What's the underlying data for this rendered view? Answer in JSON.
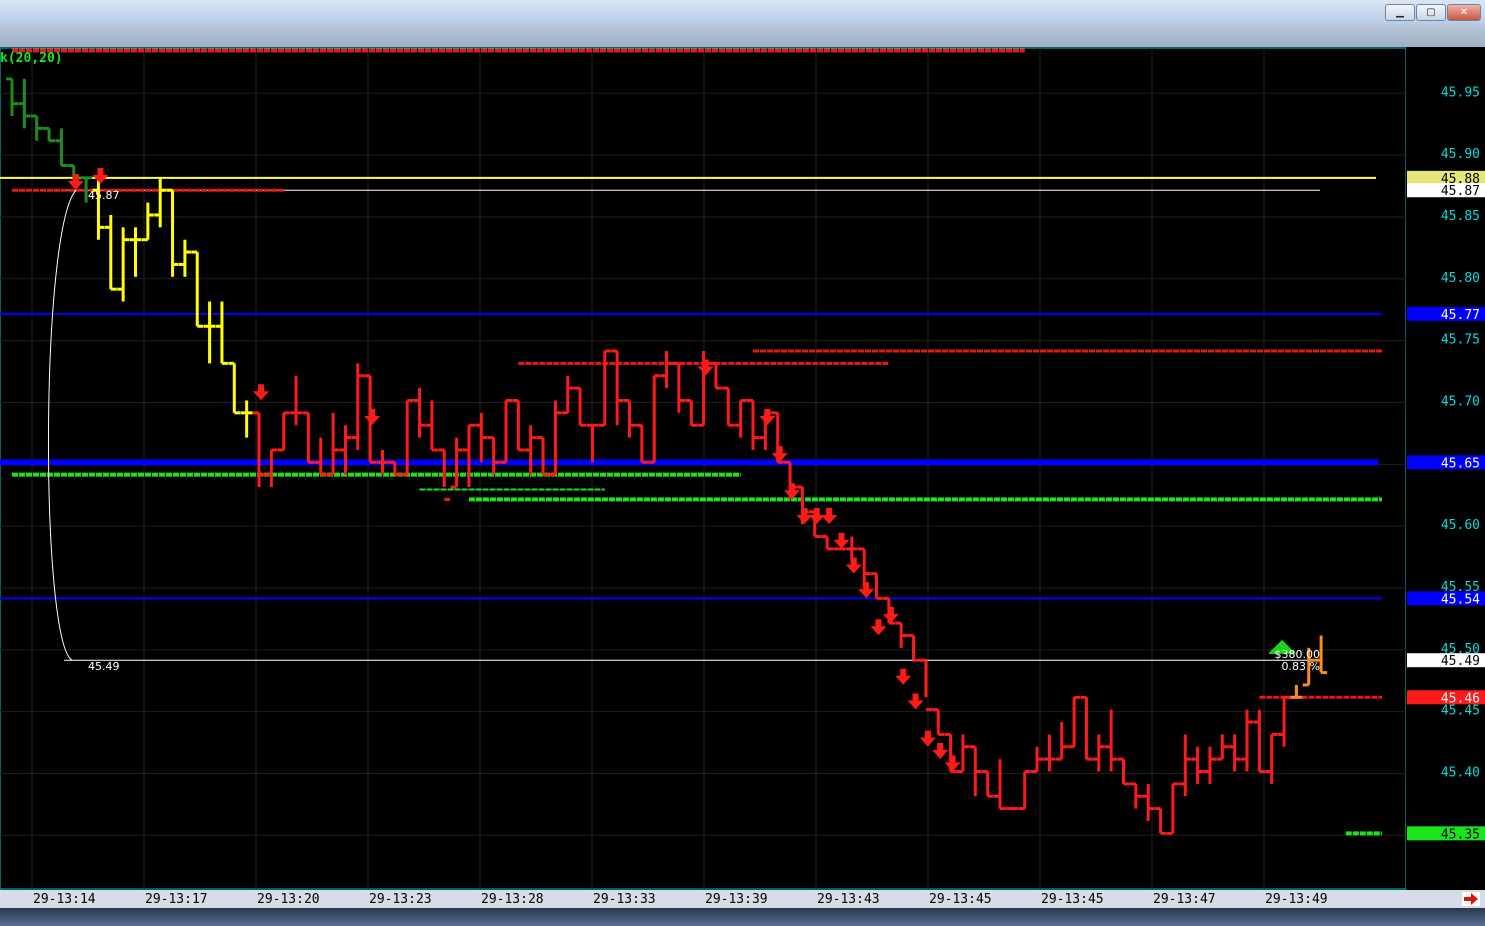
{
  "window": {
    "min_label": "▁",
    "max_label": "▢",
    "close_label": "✕"
  },
  "colors": {
    "background": "#000000",
    "grid": "#1f1f1f",
    "axis_border": "#00c8c8",
    "axis_text": "#00dede",
    "up_bar": "#ffff00",
    "down_bar": "#ff1a1a",
    "early_bar": "#1e8c1e",
    "recent_bar": "#ff8c1a",
    "blue_level": "#0000ff",
    "green_level": "#19e619",
    "red_level": "#e61919",
    "yellow_level": "#ffff4d",
    "white_level": "#ffffff",
    "sell_arrow": "#ff1a1a",
    "buy_arrow": "#1ad41a"
  },
  "chart_data": {
    "type": "ohlc",
    "indicator_label": "k(20,20)",
    "y_range": [
      45.305,
      45.985
    ],
    "y_ticks": [
      45.95,
      45.9,
      45.85,
      45.8,
      45.75,
      45.7,
      45.65,
      45.6,
      45.55,
      45.5,
      45.45,
      45.4,
      45.35
    ],
    "time_labels": [
      "29-13:14",
      "29-13:17",
      "29-13:20",
      "29-13:23",
      "29-13:28",
      "29-13:33",
      "29-13:39",
      "29-13:43",
      "29-13:45",
      "29-13:45",
      "29-13:47",
      "29-13:49"
    ],
    "price_tags": [
      {
        "value": 45.88,
        "text": "45.88",
        "bg": "#e6e678",
        "fg": "#000000"
      },
      {
        "value": 45.87,
        "text": "45.87",
        "bg": "#ffffff",
        "fg": "#000000"
      },
      {
        "value": 45.77,
        "text": "45.77",
        "bg": "#0000ff",
        "fg": "#ffffff"
      },
      {
        "value": 45.65,
        "text": "45.65",
        "bg": "#0000ff",
        "fg": "#ffffff"
      },
      {
        "value": 45.54,
        "text": "45.54",
        "bg": "#0000ff",
        "fg": "#ffffff"
      },
      {
        "value": 45.49,
        "text": "45.49",
        "bg": "#ffffff",
        "fg": "#000000"
      },
      {
        "value": 45.46,
        "text": "45.46",
        "bg": "#ff1a1a",
        "fg": "#ffffff"
      },
      {
        "value": 45.35,
        "text": "45.35",
        "bg": "#19e619",
        "fg": "#000000"
      }
    ],
    "trade_annotation": {
      "start_price": 45.87,
      "end_price": 45.49,
      "start_label": "45.87",
      "end_label": "45.49",
      "profit": "$380.00",
      "percent": "0.83 %"
    },
    "levels": [
      {
        "kind": "yellow",
        "value": 45.88,
        "from": 0,
        "to": 111
      },
      {
        "kind": "white",
        "value": 45.87,
        "from": 6,
        "to": 107
      },
      {
        "kind": "blue",
        "value": 45.77,
        "from": 0,
        "to": 111
      },
      {
        "kind": "blue_thick",
        "value": 45.65,
        "from": 0,
        "to": 111
      },
      {
        "kind": "blue",
        "value": 45.54,
        "from": 0,
        "to": 111
      },
      {
        "kind": "white",
        "value": 45.49,
        "from": 6,
        "to": 107
      },
      {
        "kind": "red_dash",
        "value": 45.983,
        "from": 0,
        "to": 82
      },
      {
        "kind": "red_dash",
        "value": 45.87,
        "from": 0,
        "to": 22
      },
      {
        "kind": "red_dash",
        "value": 45.73,
        "from": 41,
        "to": 71
      },
      {
        "kind": "red_dash",
        "value": 45.74,
        "from": 60,
        "to": 112
      },
      {
        "kind": "red_dash",
        "value": 45.46,
        "from": 101,
        "to": 112
      },
      {
        "kind": "green_dash",
        "value": 45.64,
        "from": 0,
        "to": 59
      },
      {
        "kind": "green_dash",
        "value": 45.628,
        "from": 33,
        "to": 48
      },
      {
        "kind": "green_dash",
        "value": 45.62,
        "from": 37,
        "to": 112
      },
      {
        "kind": "green_dash",
        "value": 45.35,
        "from": 108,
        "to": 112
      }
    ],
    "bars": [
      [
        45.96,
        45.96,
        45.93,
        45.94,
        "g"
      ],
      [
        45.94,
        45.96,
        45.92,
        45.93,
        "g"
      ],
      [
        45.93,
        45.93,
        45.91,
        45.92,
        "g"
      ],
      [
        45.92,
        45.92,
        45.91,
        45.91,
        "g"
      ],
      [
        45.91,
        45.92,
        45.89,
        45.89,
        "g"
      ],
      [
        45.89,
        45.89,
        45.88,
        45.88,
        "g"
      ],
      [
        45.88,
        45.88,
        45.86,
        45.88,
        "g"
      ],
      [
        45.87,
        45.88,
        45.83,
        45.84,
        "y"
      ],
      [
        45.84,
        45.85,
        45.79,
        45.79,
        "y"
      ],
      [
        45.79,
        45.84,
        45.78,
        45.83,
        "y"
      ],
      [
        45.83,
        45.84,
        45.8,
        45.83,
        "y"
      ],
      [
        45.83,
        45.86,
        45.83,
        45.85,
        "y"
      ],
      [
        45.85,
        45.88,
        45.84,
        45.87,
        "y"
      ],
      [
        45.87,
        45.87,
        45.8,
        45.81,
        "y"
      ],
      [
        45.81,
        45.83,
        45.8,
        45.82,
        "y"
      ],
      [
        45.82,
        45.82,
        45.76,
        45.76,
        "y"
      ],
      [
        45.76,
        45.78,
        45.73,
        45.76,
        "y"
      ],
      [
        45.76,
        45.78,
        45.73,
        45.73,
        "y"
      ],
      [
        45.73,
        45.73,
        45.69,
        45.69,
        "y"
      ],
      [
        45.69,
        45.7,
        45.67,
        45.69,
        "y"
      ],
      [
        45.69,
        45.69,
        45.63,
        45.64,
        "r"
      ],
      [
        45.64,
        45.66,
        45.63,
        45.66,
        "r"
      ],
      [
        45.66,
        45.69,
        45.66,
        45.69,
        "r"
      ],
      [
        45.69,
        45.72,
        45.68,
        45.69,
        "r"
      ],
      [
        45.69,
        45.69,
        45.65,
        45.65,
        "r"
      ],
      [
        45.65,
        45.67,
        45.64,
        45.64,
        "r"
      ],
      [
        45.64,
        45.69,
        45.64,
        45.66,
        "r"
      ],
      [
        45.66,
        45.68,
        45.64,
        45.67,
        "r"
      ],
      [
        45.67,
        45.73,
        45.66,
        45.72,
        "r"
      ],
      [
        45.72,
        45.72,
        45.65,
        45.65,
        "r"
      ],
      [
        45.65,
        45.66,
        45.64,
        45.65,
        "r"
      ],
      [
        45.65,
        45.65,
        45.64,
        45.64,
        "r"
      ],
      [
        45.64,
        45.7,
        45.64,
        45.7,
        "r"
      ],
      [
        45.7,
        45.71,
        45.67,
        45.68,
        "r"
      ],
      [
        45.68,
        45.7,
        45.66,
        45.66,
        "r"
      ],
      [
        45.66,
        45.66,
        45.63,
        45.62,
        "r"
      ],
      [
        45.63,
        45.67,
        45.63,
        45.66,
        "r"
      ],
      [
        45.66,
        45.68,
        45.63,
        45.68,
        "r"
      ],
      [
        45.68,
        45.69,
        45.65,
        45.67,
        "r"
      ],
      [
        45.67,
        45.67,
        45.64,
        45.65,
        "r"
      ],
      [
        45.65,
        45.7,
        45.65,
        45.7,
        "r"
      ],
      [
        45.7,
        45.7,
        45.66,
        45.66,
        "r"
      ],
      [
        45.66,
        45.68,
        45.64,
        45.67,
        "r"
      ],
      [
        45.67,
        45.67,
        45.64,
        45.64,
        "r"
      ],
      [
        45.64,
        45.7,
        45.64,
        45.69,
        "r"
      ],
      [
        45.69,
        45.72,
        45.69,
        45.71,
        "r"
      ],
      [
        45.71,
        45.71,
        45.68,
        45.68,
        "r"
      ],
      [
        45.68,
        45.68,
        45.65,
        45.68,
        "r"
      ],
      [
        45.68,
        45.74,
        45.68,
        45.74,
        "r"
      ],
      [
        45.74,
        45.74,
        45.68,
        45.7,
        "r"
      ],
      [
        45.7,
        45.7,
        45.67,
        45.68,
        "r"
      ],
      [
        45.68,
        45.68,
        45.65,
        45.65,
        "r"
      ],
      [
        45.65,
        45.72,
        45.65,
        45.72,
        "r"
      ],
      [
        45.72,
        45.74,
        45.71,
        45.73,
        "r"
      ],
      [
        45.73,
        45.73,
        45.69,
        45.7,
        "r"
      ],
      [
        45.7,
        45.7,
        45.68,
        45.68,
        "r"
      ],
      [
        45.68,
        45.74,
        45.68,
        45.73,
        "r"
      ],
      [
        45.73,
        45.73,
        45.71,
        45.71,
        "r"
      ],
      [
        45.71,
        45.71,
        45.68,
        45.68,
        "r"
      ],
      [
        45.68,
        45.7,
        45.67,
        45.7,
        "r"
      ],
      [
        45.7,
        45.7,
        45.66,
        45.67,
        "r"
      ],
      [
        45.67,
        45.69,
        45.66,
        45.69,
        "r"
      ],
      [
        45.69,
        45.69,
        45.65,
        45.65,
        "r"
      ],
      [
        45.65,
        45.65,
        45.62,
        45.63,
        "r"
      ],
      [
        45.63,
        45.63,
        45.6,
        45.61,
        "r"
      ],
      [
        45.61,
        45.61,
        45.59,
        45.59,
        "r"
      ],
      [
        45.59,
        45.59,
        45.58,
        45.58,
        "r"
      ],
      [
        45.58,
        45.58,
        45.58,
        45.58,
        "r"
      ],
      [
        45.58,
        45.59,
        45.57,
        45.58,
        "r"
      ],
      [
        45.58,
        45.58,
        45.55,
        45.56,
        "r"
      ],
      [
        45.56,
        45.56,
        45.54,
        45.54,
        "r"
      ],
      [
        45.54,
        45.54,
        45.52,
        45.52,
        "r"
      ],
      [
        45.52,
        45.52,
        45.5,
        45.51,
        "r"
      ],
      [
        45.51,
        45.51,
        45.49,
        45.49,
        "r"
      ],
      [
        45.49,
        45.49,
        45.46,
        45.45,
        "r"
      ],
      [
        45.45,
        45.45,
        45.43,
        45.43,
        "r"
      ],
      [
        45.43,
        45.43,
        45.4,
        45.4,
        "r"
      ],
      [
        45.4,
        45.43,
        45.4,
        45.42,
        "r"
      ],
      [
        45.42,
        45.42,
        45.38,
        45.4,
        "r"
      ],
      [
        45.4,
        45.4,
        45.38,
        45.38,
        "r"
      ],
      [
        45.38,
        45.41,
        45.37,
        45.37,
        "r"
      ],
      [
        45.37,
        45.37,
        45.37,
        45.37,
        "r"
      ],
      [
        45.37,
        45.4,
        45.37,
        45.4,
        "r"
      ],
      [
        45.4,
        45.42,
        45.4,
        45.41,
        "r"
      ],
      [
        45.41,
        45.43,
        45.4,
        45.41,
        "r"
      ],
      [
        45.41,
        45.44,
        45.41,
        45.42,
        "r"
      ],
      [
        45.42,
        45.46,
        45.42,
        45.46,
        "r"
      ],
      [
        45.46,
        45.46,
        45.41,
        45.41,
        "r"
      ],
      [
        45.41,
        45.43,
        45.4,
        45.42,
        "r"
      ],
      [
        45.42,
        45.45,
        45.4,
        45.41,
        "r"
      ],
      [
        45.41,
        45.41,
        45.39,
        45.39,
        "r"
      ],
      [
        45.39,
        45.39,
        45.37,
        45.38,
        "r"
      ],
      [
        45.38,
        45.39,
        45.36,
        45.37,
        "r"
      ],
      [
        45.37,
        45.37,
        45.35,
        45.35,
        "r"
      ],
      [
        45.35,
        45.39,
        45.35,
        45.39,
        "r"
      ],
      [
        45.39,
        45.43,
        45.38,
        45.41,
        "r"
      ],
      [
        45.41,
        45.42,
        45.39,
        45.4,
        "r"
      ],
      [
        45.4,
        45.42,
        45.39,
        45.41,
        "r"
      ],
      [
        45.41,
        45.43,
        45.41,
        45.42,
        "r"
      ],
      [
        45.42,
        45.43,
        45.4,
        45.41,
        "r"
      ],
      [
        45.41,
        45.45,
        45.4,
        45.44,
        "r"
      ],
      [
        45.44,
        45.45,
        45.4,
        45.4,
        "r"
      ],
      [
        45.4,
        45.43,
        45.39,
        45.43,
        "r"
      ],
      [
        45.43,
        45.46,
        45.42,
        45.46,
        "r"
      ],
      [
        45.46,
        45.47,
        45.46,
        45.46,
        "o"
      ],
      [
        45.47,
        45.5,
        45.47,
        45.49,
        "o"
      ],
      [
        45.49,
        45.51,
        45.48,
        45.48,
        "o"
      ]
    ],
    "sell_signals": [
      [
        20,
        45.705
      ],
      [
        29,
        45.685
      ],
      [
        56,
        45.725
      ],
      [
        61,
        45.685
      ],
      [
        62,
        45.655
      ],
      [
        63,
        45.625
      ],
      [
        64,
        45.605
      ],
      [
        65,
        45.605
      ],
      [
        66,
        45.605
      ],
      [
        67,
        45.585
      ],
      [
        68,
        45.565
      ],
      [
        69,
        45.545
      ],
      [
        70,
        45.515
      ],
      [
        71,
        45.525
      ],
      [
        72,
        45.475
      ],
      [
        73,
        45.455
      ],
      [
        74,
        45.425
      ],
      [
        75,
        45.415
      ],
      [
        76,
        45.405
      ],
      [
        5,
        45.875
      ],
      [
        7,
        45.88
      ]
    ],
    "buy_signals": [
      [
        103,
        45.5
      ]
    ]
  }
}
